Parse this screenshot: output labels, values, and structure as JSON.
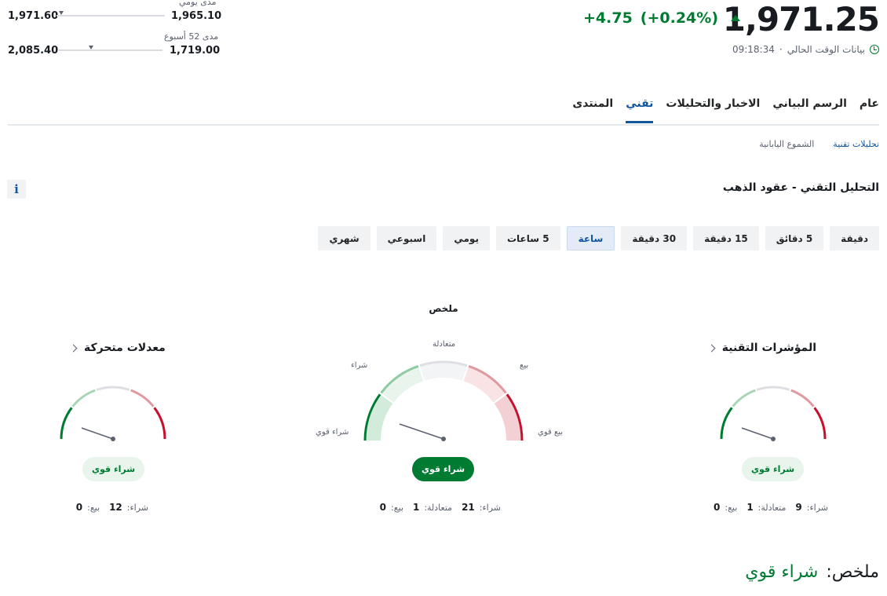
{
  "header": {
    "price": "1,971.25",
    "change": "+4.75",
    "change_pct": "(+0.24%)",
    "time_label": "بيانات الوقت الحالي",
    "time": "09:18:34"
  },
  "ranges": {
    "daily": {
      "label": "مدى يومي",
      "low": "1,965.10",
      "high": "1,971.60"
    },
    "week52": {
      "label": "مدى 52 أسبوع",
      "low": "1,719.00",
      "high": "2,085.40"
    }
  },
  "tabs": [
    {
      "label": "عام"
    },
    {
      "label": "الرسم البياني"
    },
    {
      "label": "الاخبار والتحليلات"
    },
    {
      "label": "تقني"
    },
    {
      "label": "المنتدى"
    }
  ],
  "subtabs": [
    {
      "label": "تحليلات تقنية"
    },
    {
      "label": "الشموع اليابانية"
    }
  ],
  "section_title": "التحليل التقني - عقود الذهب",
  "info_label": "i",
  "periods": [
    "دقيقة",
    "5 دقائق",
    "15 دقيقة",
    "30 دقيقة",
    "ساعة",
    "5 ساعات",
    "يومي",
    "اسبوعي",
    "شهري"
  ],
  "summary_heading": "ملخص",
  "gauges": {
    "indicators": {
      "title": "المؤشرات التقنية",
      "signal": "شراء قوي",
      "buy_label": "شراء:",
      "buy": "9",
      "neutral_label": "متعادلة:",
      "neutral": "1",
      "sell_label": "بيع:",
      "sell": "0"
    },
    "summary": {
      "signal": "شراء قوي",
      "buy_label": "شراء:",
      "buy": "21",
      "neutral_label": "متعادلة:",
      "neutral": "1",
      "sell_label": "بيع:",
      "sell": "0",
      "labels": {
        "strong_buy": "شراء قوي",
        "buy": "شراء",
        "neutral": "متعادلة",
        "sell": "بيع",
        "strong_sell": "بيع قوي"
      }
    },
    "moving_averages": {
      "title": "معدلات متحركة",
      "signal": "شراء قوي",
      "buy_label": "شراء:",
      "buy": "12",
      "sell_label": "بيع:",
      "sell": "0"
    }
  },
  "final": {
    "label": "ملخص:",
    "value": "شراء قوي"
  },
  "colors": {
    "up": "#007c32",
    "accent": "#1256a0",
    "strong_sell": "#c8102e"
  }
}
